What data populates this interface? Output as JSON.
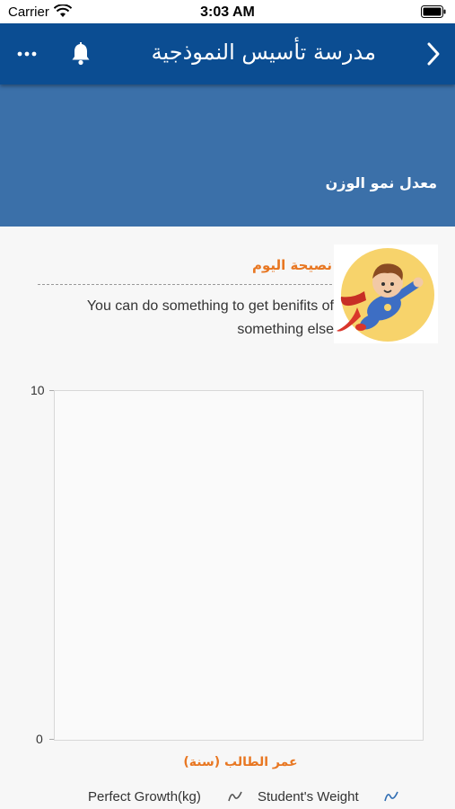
{
  "status_bar": {
    "carrier": "Carrier",
    "time": "3:03 AM"
  },
  "nav": {
    "title": "مدرسة تأسيس النموذجية"
  },
  "header": {
    "subtitle": "معدل نمو الوزن"
  },
  "tip": {
    "title": "نصيحة اليوم",
    "text": "You can do something to get benifits of something else"
  },
  "chart_data": {
    "type": "line",
    "title": "",
    "xlabel": "عمر الطالب (سنة)",
    "ylabel": "",
    "ylim": [
      0,
      10
    ],
    "y_ticks": [
      "10",
      "0"
    ],
    "grid": false,
    "series": [
      {
        "name": "Perfect Growth(kg)",
        "color": "#555555",
        "values": []
      },
      {
        "name": "Student's Weight",
        "color": "#2f6db3",
        "values": []
      }
    ],
    "legend_position": "bottom"
  },
  "icons": {
    "more": "more-icon",
    "bell": "bell-icon",
    "back": "chevron-right-icon",
    "tip_image": "superhero-illustration"
  },
  "colors": {
    "nav": "#0b4d92",
    "banner": "#3b70a9",
    "accent": "#e87722"
  }
}
